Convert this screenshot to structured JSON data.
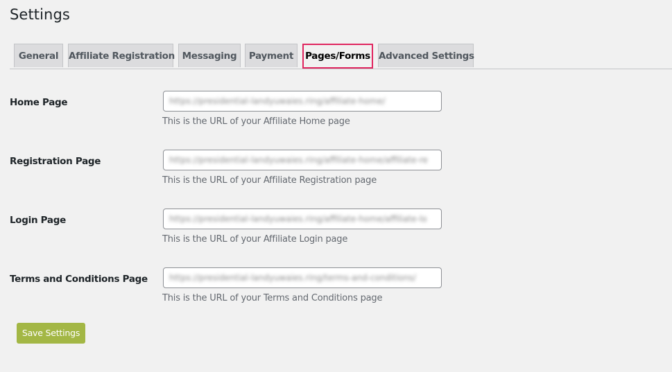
{
  "page": {
    "title": "Settings"
  },
  "tabs": [
    {
      "label": "General",
      "active": false
    },
    {
      "label": "Affiliate Registration",
      "active": false
    },
    {
      "label": "Messaging",
      "active": false
    },
    {
      "label": "Payment",
      "active": false
    },
    {
      "label": "Pages/Forms",
      "active": true
    },
    {
      "label": "Advanced Settings",
      "active": false
    }
  ],
  "fields": [
    {
      "label": "Home Page",
      "value": "https://presidential-landyuwaies.ring/affiliate-home/",
      "value_blurred": true,
      "description": "This is the URL of your Affiliate Home page"
    },
    {
      "label": "Registration Page",
      "value": "https://presidential-landyuwaies.ring/affiliate-home/affiliate-re",
      "value_blurred": true,
      "description": "This is the URL of your Affiliate Registration page"
    },
    {
      "label": "Login Page",
      "value": "https://presidential-landyuwaies.ring/affiliate-home/affiliate-lo",
      "value_blurred": true,
      "description": "This is the URL of your Affiliate Login page"
    },
    {
      "label": "Terms and Conditions Page",
      "value": "https://presidential-landyuwaies.ring/terms-and-conditions/",
      "value_blurred": true,
      "description": "This is the URL of your Terms and Conditions page"
    }
  ],
  "actions": {
    "save_label": "Save Settings"
  },
  "colors": {
    "background": "#f1f1f1",
    "tab_inactive_bg": "#dcdcde",
    "active_tab_highlight": "#e0245e",
    "save_button_bg": "#a3b745",
    "description_text": "#646970"
  }
}
